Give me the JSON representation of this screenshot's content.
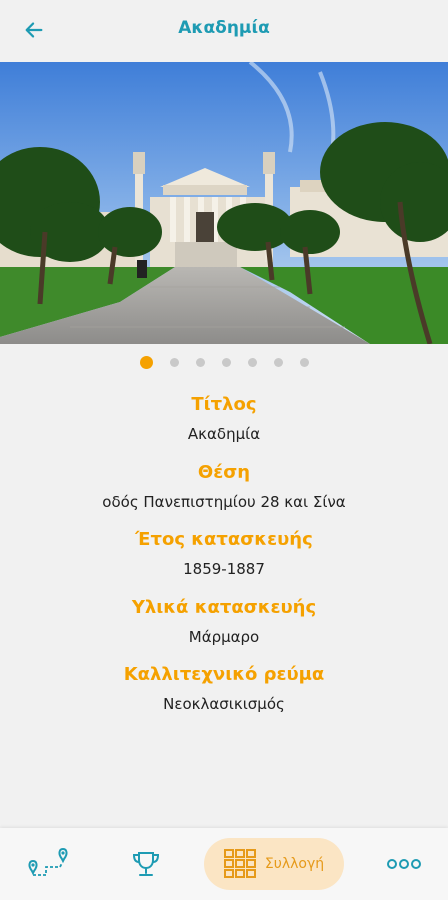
{
  "header": {
    "title": "Ακαδημία",
    "back_icon": "arrow-left-icon"
  },
  "carousel": {
    "total": 7,
    "active_index": 0
  },
  "details": [
    {
      "label": "Τίτλος",
      "value": "Ακαδημία"
    },
    {
      "label": "Θέση",
      "value": "οδός Πανεπιστημίου 28 και Σίνα"
    },
    {
      "label": "Έτος κατασκευής",
      "value": "1859-1887"
    },
    {
      "label": "Υλικά κατασκευής",
      "value": "Μάρμαρο"
    },
    {
      "label": "Καλλιτεχνικό ρεύμα",
      "value": "Νεοκλασικισμός"
    }
  ],
  "bottom_nav": {
    "map_icon": "map-route-icon",
    "trophy_icon": "trophy-icon",
    "collection_icon": "grid-icon",
    "collection_label": "Συλλογή",
    "more_icon": "more-dots-icon",
    "active": "collection"
  },
  "colors": {
    "accent": "#f5a100",
    "primary": "#1e9bb3",
    "active_pill": "#fbe5c4",
    "inactive_dot": "#c9c9c9"
  }
}
